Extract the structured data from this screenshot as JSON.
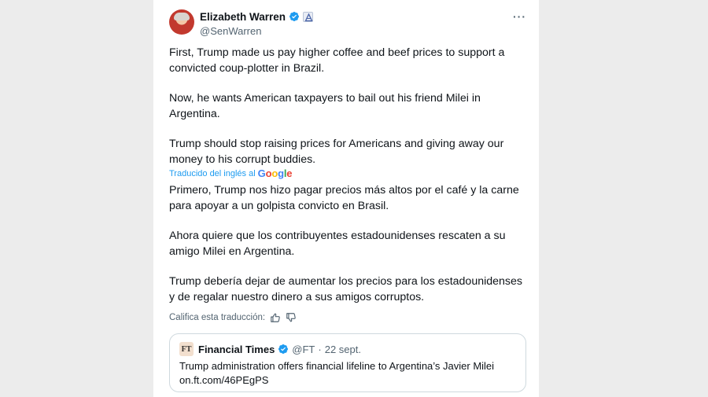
{
  "tweet": {
    "author_name": "Elizabeth Warren",
    "handle": "@SenWarren",
    "more_label": "···",
    "paragraphs": [
      "First, Trump made us pay higher coffee and beef prices to support a convicted coup-plotter in Brazil.",
      "Now, he wants American taxpayers to bail out his friend Milei in Argentina.",
      "Trump should stop raising prices for Americans and giving away our money to his corrupt buddies."
    ]
  },
  "translation": {
    "label": "Traducido del inglés al",
    "provider": "Google",
    "paragraphs": [
      "Primero, Trump nos hizo pagar precios más altos por el café y la carne para apoyar a un golpista convicto en Brasil.",
      "Ahora quiere que los contribuyentes estadounidenses rescaten a su amigo Milei en Argentina.",
      "Trump debería dejar de aumentar los precios para los estadounidenses y de regalar nuestro dinero a sus amigos corruptos."
    ],
    "rate_label": "Califica esta traducción:"
  },
  "quote": {
    "logo_text": "FT",
    "name": "Financial Times",
    "handle": "@FT",
    "separator": "·",
    "date": "22 sept.",
    "headline": "Trump administration offers financial lifeline to Argentina’s Javier Milei",
    "link": "on.ft.com/46PEgPS"
  },
  "colors": {
    "verified": "#1d9bf0",
    "link_blue": "#1d9bf0",
    "secondary_text": "#536471"
  },
  "icons": [
    "verified-badge-icon",
    "government-badge-icon",
    "more-options-icon",
    "thumbs-up-icon",
    "thumbs-down-icon",
    "ft-logo"
  ]
}
